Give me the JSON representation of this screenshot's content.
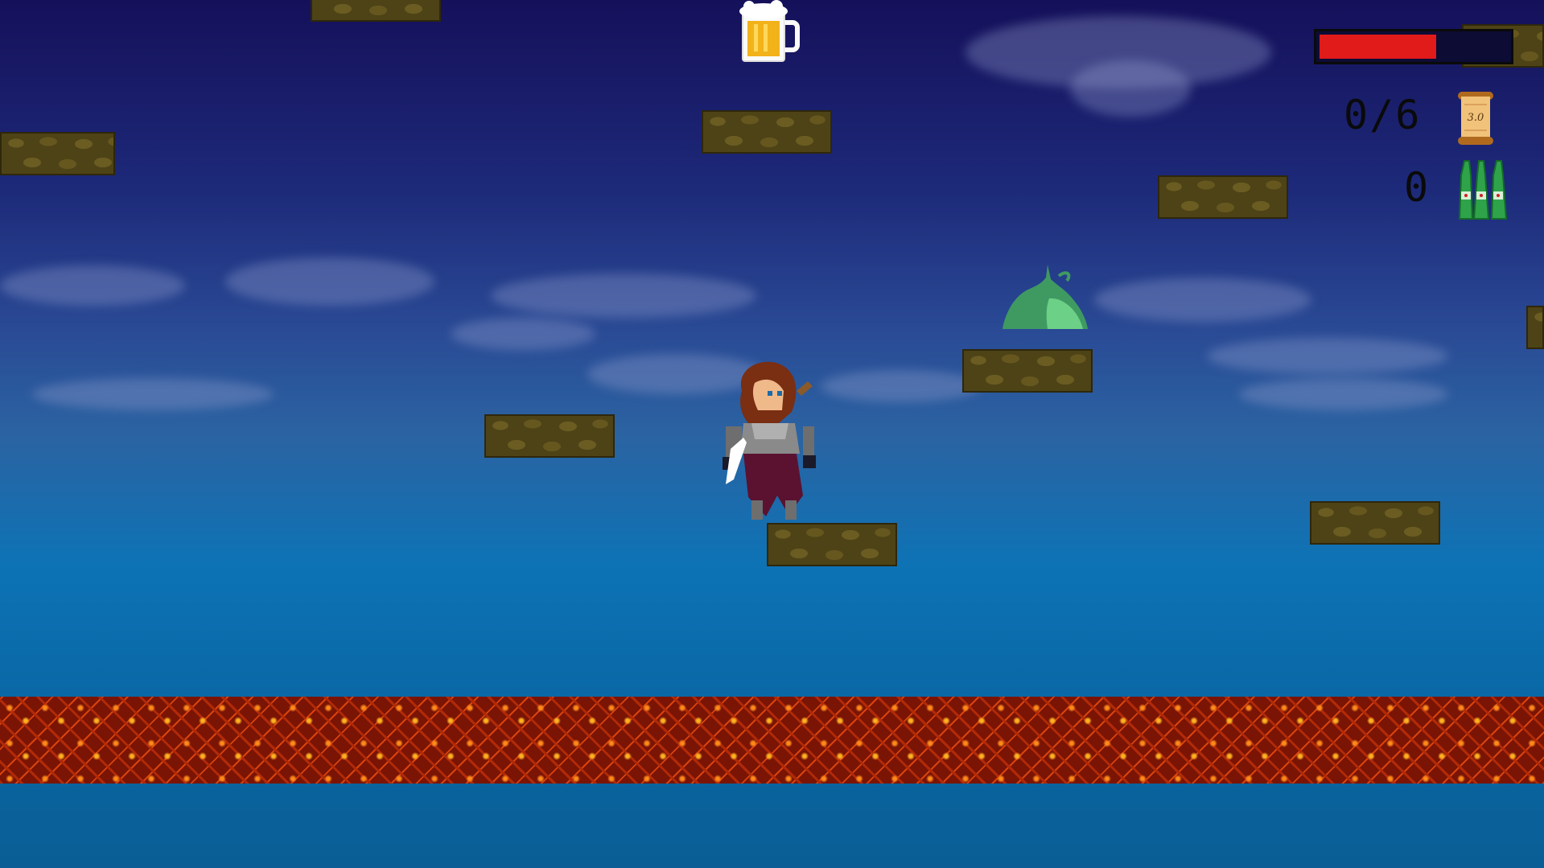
{
  "hud": {
    "health_fraction": 0.62,
    "scrolls_collected": "0/6",
    "scroll_icon_label": "3.0",
    "bottles_count": "0"
  },
  "icons": {
    "beer": "beer-mug-icon",
    "scroll": "scroll-icon",
    "bottles": "bottles-icon",
    "slime": "slime-enemy",
    "player": "heroine-sprite"
  },
  "colors": {
    "health": "#e11a1a",
    "health_empty": "#0c0c35",
    "lava": "#c2300a",
    "platform": "#4d4316"
  }
}
